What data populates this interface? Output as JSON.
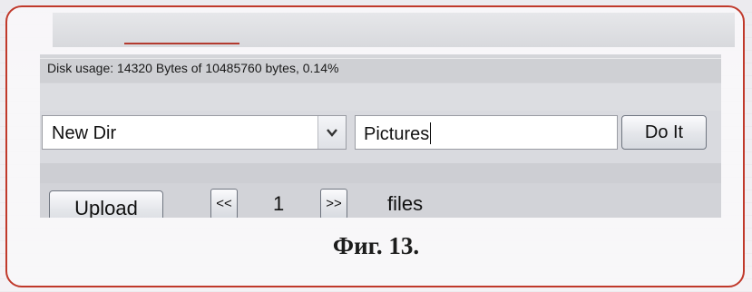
{
  "status": {
    "disk_usage": "Disk usage: 14320 Bytes of 10485760 bytes, 0.14%"
  },
  "form": {
    "action_select": {
      "value": "New Dir",
      "icon": "chevron-down-icon"
    },
    "name_input": {
      "value": "Pictures"
    },
    "submit_label": "Do It"
  },
  "files_bar": {
    "upload_label": "Upload",
    "prev_label": "<<",
    "page": "1",
    "next_label": ">>",
    "files_label": "files"
  },
  "caption": "Фиг. 13.",
  "colors": {
    "frame_border": "#c0392b",
    "panel": "#d4d5d9"
  }
}
